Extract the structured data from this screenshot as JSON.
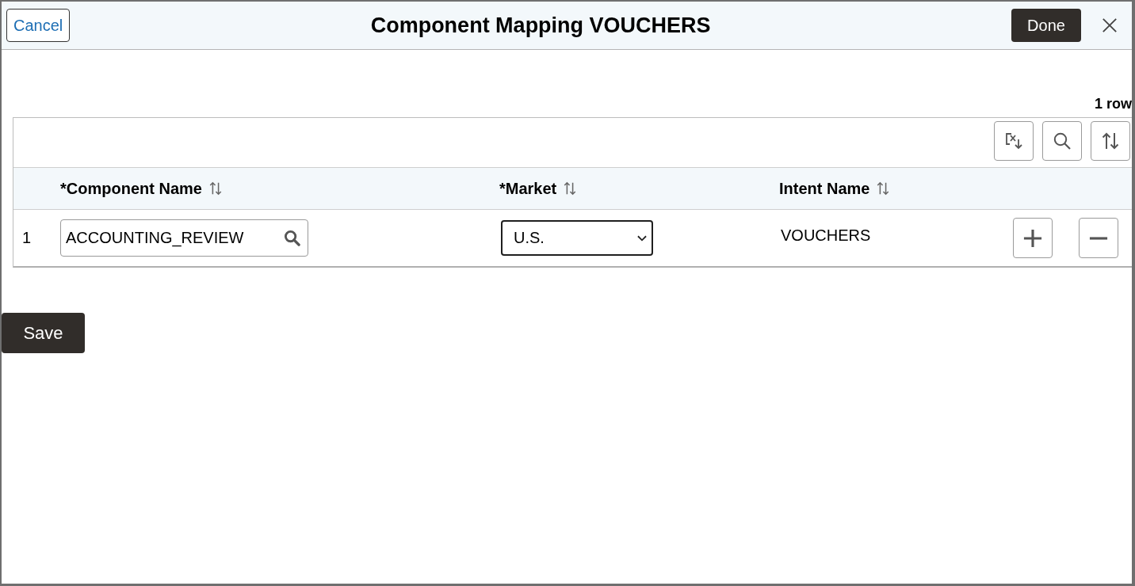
{
  "dialog": {
    "cancel_button": "Cancel",
    "title": "Component Mapping VOUCHERS",
    "done_button": "Done"
  },
  "grid": {
    "row_count": "1 row",
    "columns": [
      {
        "label": "*Component Name",
        "sortable": true
      },
      {
        "label": "*Market",
        "sortable": true
      },
      {
        "label": "Intent Name",
        "sortable": true
      }
    ],
    "rows": [
      {
        "number": "1",
        "component_name": "ACCOUNTING_REVIEW",
        "market": {
          "value": "U.S.",
          "focused": true
        },
        "intent_name": "VOUCHERS"
      }
    ]
  },
  "save_button": "Save"
}
